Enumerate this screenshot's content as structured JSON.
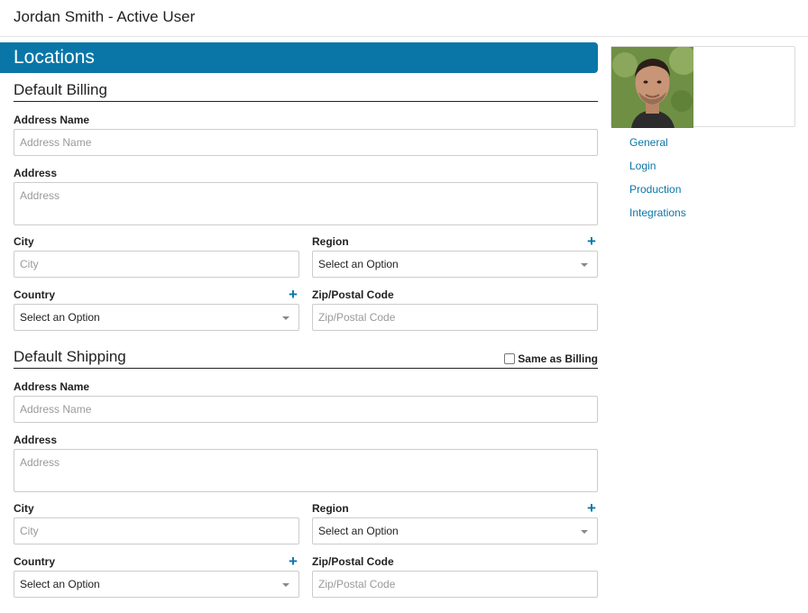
{
  "header": {
    "title": "Jordan Smith - Active User"
  },
  "banner": {
    "title": "Locations"
  },
  "billing": {
    "section_title": "Default Billing",
    "address_name_label": "Address Name",
    "address_name_placeholder": "Address Name",
    "address_label": "Address",
    "address_placeholder": "Address",
    "city_label": "City",
    "city_placeholder": "City",
    "region_label": "Region",
    "region_value": "Select an Option",
    "country_label": "Country",
    "country_value": "Select an Option",
    "zip_label": "Zip/Postal Code",
    "zip_placeholder": "Zip/Postal Code"
  },
  "shipping": {
    "section_title": "Default Shipping",
    "same_as_billing": "Same as Billing",
    "address_name_label": "Address Name",
    "address_name_placeholder": "Address Name",
    "address_label": "Address",
    "address_placeholder": "Address",
    "city_label": "City",
    "city_placeholder": "City",
    "region_label": "Region",
    "region_value": "Select an Option",
    "country_label": "Country",
    "country_value": "Select an Option",
    "zip_label": "Zip/Postal Code",
    "zip_placeholder": "Zip/Postal Code"
  },
  "plus_icon": "+",
  "sidebar": {
    "items": [
      {
        "label": "General"
      },
      {
        "label": "Login"
      },
      {
        "label": "Production"
      },
      {
        "label": "Integrations"
      }
    ]
  },
  "colors": {
    "accent": "#0a76a8"
  }
}
